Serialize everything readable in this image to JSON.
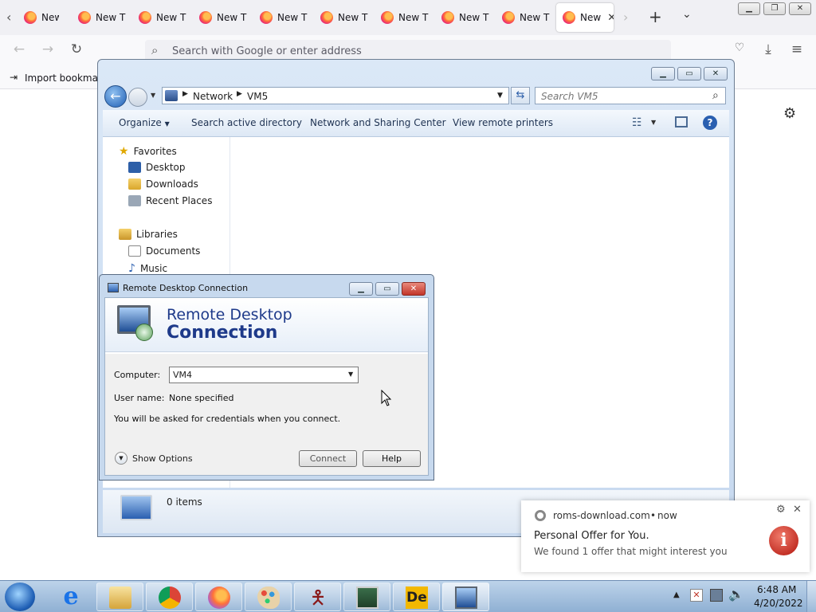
{
  "browser": {
    "tabs": [
      "New T",
      "New T",
      "New T",
      "New T",
      "New T",
      "New T",
      "New T",
      "New T",
      "New T",
      "New T"
    ],
    "active_tab_label": "New",
    "url_placeholder": "Search with Google or enter address",
    "bookmark_import": "Import bookmarks..."
  },
  "explorer": {
    "address": {
      "root": "Network",
      "current": "VM5"
    },
    "search_placeholder": "Search VM5",
    "commands": [
      "Organize",
      "Search active directory",
      "Network and Sharing Center",
      "View remote printers"
    ],
    "nav": {
      "favorites": "Favorites",
      "favorite_items": [
        "Desktop",
        "Downloads",
        "Recent Places"
      ],
      "libraries": "Libraries",
      "library_items": [
        "Documents",
        "Music"
      ]
    },
    "status_items": "0 items"
  },
  "rdc": {
    "title": "Remote Desktop Connection",
    "banner_line1": "Remote Desktop",
    "banner_line2": "Connection",
    "computer_label": "Computer:",
    "computer_value": "VM4",
    "username_label": "User name:",
    "username_value": "None specified",
    "credentials_note": "You will be asked for credentials when you connect.",
    "show_options": "Show Options",
    "connect": "Connect",
    "help": "Help"
  },
  "notification": {
    "source": "roms-download.com",
    "time": "now",
    "title": "Personal Offer for You.",
    "body": "We found 1 offer that might interest you"
  },
  "taskbar": {
    "time": "6:48 AM",
    "date": "4/20/2022"
  },
  "colors": {
    "win7_accent": "#1e3a8a",
    "close_red": "#c0392b"
  }
}
